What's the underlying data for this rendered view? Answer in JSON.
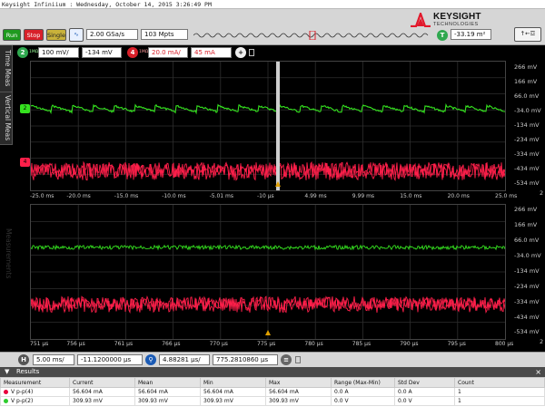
{
  "window": {
    "title": "Keysight Infiniium : Wednesday, October 14, 2015 3:26:49 PM"
  },
  "brand": {
    "name": "KEYSIGHT",
    "tagline": "TECHNOLOGIES"
  },
  "toolbar": {
    "run": "Run",
    "stop": "Stop",
    "single": "Single",
    "sample_rate": "2.00 GSa/s",
    "memory_depth": "103 Mpts",
    "trigger_level": "-33.19 m²",
    "trigger_marker": "T"
  },
  "channels": {
    "ch2": {
      "num": "2",
      "coupling": "1MΩ",
      "scale": "100 mV/",
      "offset": "-134 mV"
    },
    "ch4": {
      "num": "4",
      "coupling": "1MΩ",
      "scale": "20.0 mA/",
      "offset": "45 mA"
    }
  },
  "tabs": {
    "time_meas": "Time Meas",
    "vertical_meas": "Vertical Meas",
    "measurements": "Measurements"
  },
  "upper_grid": {
    "right_labels": [
      "266 mV",
      "166 mV",
      "66.0 mV",
      "-34.0 mV",
      "-134 mV",
      "-234 mV",
      "-334 mV",
      "-434 mV",
      "-534 mV"
    ],
    "right_scale": "2",
    "x_labels": [
      "-25.0 ms",
      "-20.0 ms",
      "-15.0 ms",
      "-10.0 ms",
      "-5.01 ms",
      "-10 µs",
      "4.99 ms",
      "9.99 ms",
      "15.0 ms",
      "20.0 ms",
      "25.0 ms"
    ]
  },
  "lower_grid": {
    "right_labels": [
      "266 mV",
      "166 mV",
      "66.0 mV",
      "-34.0 mV",
      "-134 mV",
      "-234 mV",
      "-334 mV",
      "-434 mV",
      "-534 mV"
    ],
    "right_scale": "2",
    "x_labels": [
      "751 µs",
      "756 µs",
      "761 µs",
      "766 µs",
      "770 µs",
      "775 µs",
      "780 µs",
      "785 µs",
      "790 µs",
      "795 µs",
      "800 µs"
    ]
  },
  "timebase": {
    "h_label": "H",
    "scale": "5.00 ms/",
    "position": "-11.1200000 µs",
    "zoom_scale": "4.88281 µs/",
    "zoom_position": "775.2810860 µs"
  },
  "results": {
    "title": "Results",
    "columns": [
      "Measurement",
      "Current",
      "Mean",
      "Min",
      "Max",
      "Range (Max-Min)",
      "Std Dev",
      "Count"
    ],
    "rows": [
      {
        "name": "V p-p(4)",
        "color": "#e8003c",
        "current": "56.604 mA",
        "mean": "56.604 mA",
        "min": "56.604 mA",
        "max": "56.604 mA",
        "range": "0.0 A",
        "std": "0.0 A",
        "count": "1"
      },
      {
        "name": "V p-p(2)",
        "color": "#2ecc2e",
        "current": "309.93 mV",
        "mean": "309.93 mV",
        "min": "309.93 mV",
        "max": "309.93 mV",
        "range": "0.0 V",
        "std": "0.0 V",
        "count": "1"
      }
    ]
  },
  "colors": {
    "ch2": "#35e21f",
    "ch4": "#ff1f4a",
    "grid": "#2e2e2e"
  },
  "icons": [
    "zoom-icon",
    "trigger-edge-icon",
    "add-icon",
    "results-toggle-icon",
    "close-icon"
  ]
}
